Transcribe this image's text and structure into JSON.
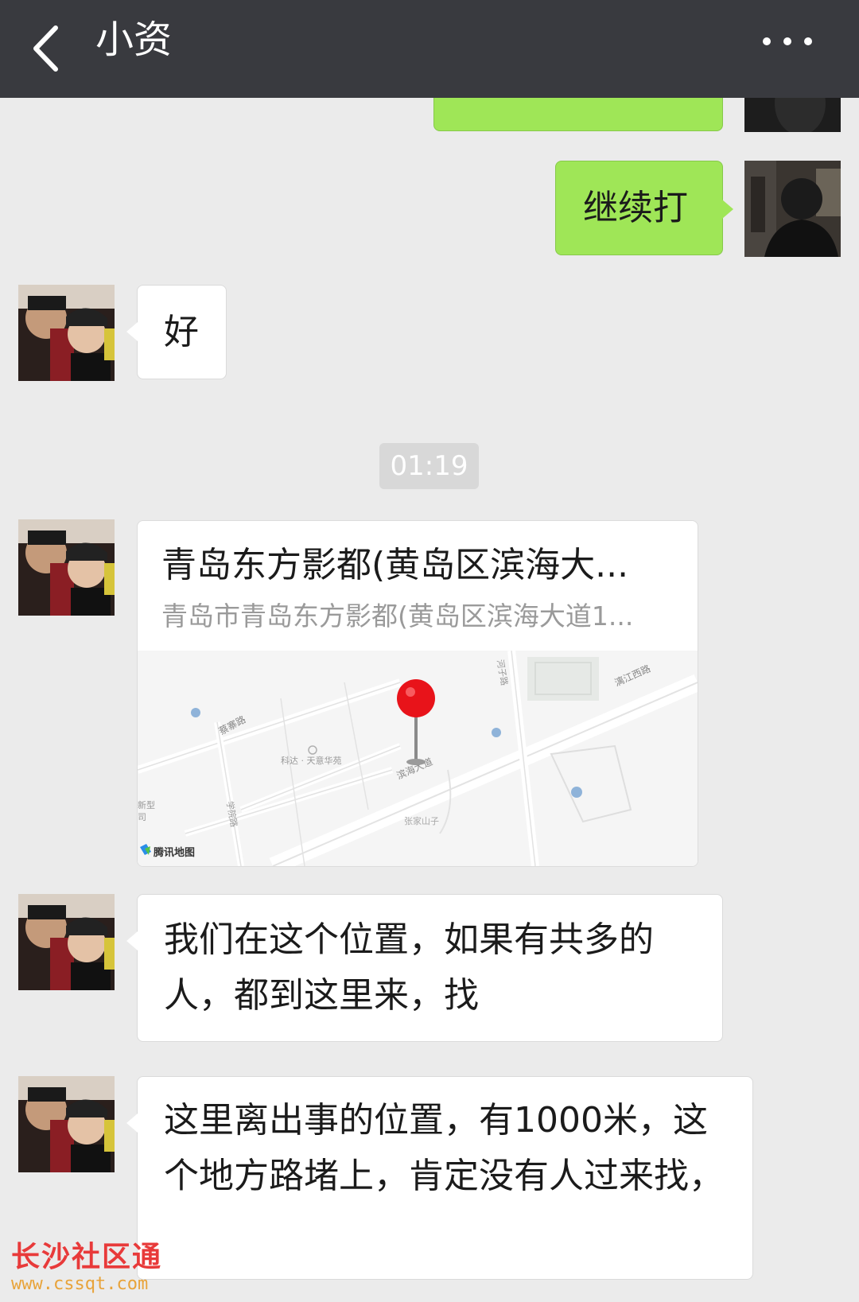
{
  "header": {
    "title": "小资",
    "back_icon": "chevron-left-icon",
    "more_icon": "more-dots-icon"
  },
  "messages": [
    {
      "side": "right",
      "type": "text",
      "text": "继续打"
    },
    {
      "side": "left",
      "type": "text",
      "text": "好"
    },
    {
      "type": "timestamp",
      "text": "01:19"
    },
    {
      "side": "left",
      "type": "location",
      "name": "青岛东方影都(黄岛区滨海大...",
      "address": "青岛市青岛东方影都(黄岛区滨海大道1...",
      "map": {
        "labels": [
          "蔡寨路",
          "滨海大道",
          "漓江西路",
          "科达 · 天意华苑",
          "学院路",
          "张家山子",
          "河子路",
          "新型",
          "司"
        ],
        "brand": "腾讯地图"
      }
    },
    {
      "side": "left",
      "type": "text",
      "text": "我们在这个位置，如果有共多的人，都到这里来，找"
    },
    {
      "side": "left",
      "type": "text",
      "text": "这里离出事的位置，有1000米，这个地方路堵上，肯定没有人过来找，"
    }
  ],
  "watermark": {
    "name": "长沙社区通",
    "url": "www.cssqt.com"
  },
  "colors": {
    "topbar": "#393a3f",
    "background": "#ebebeb",
    "sent_bubble": "#9fe657",
    "received_bubble": "#ffffff",
    "timestamp_bg": "#d8d8d8"
  }
}
